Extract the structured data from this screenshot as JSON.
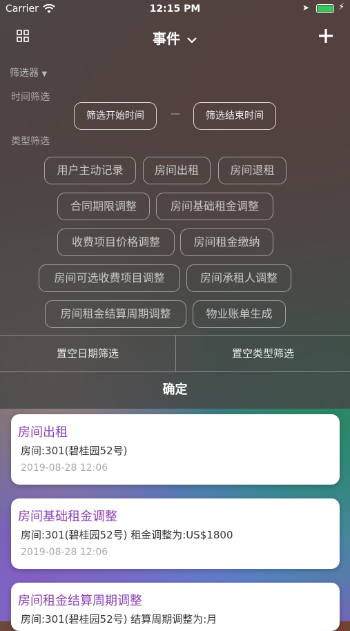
{
  "status_bar": {
    "carrier": "Carrier",
    "time": "12:15 PM"
  },
  "nav": {
    "title": "事件",
    "title_icon": "chevron-down-icon"
  },
  "filter": {
    "label": "筛选器",
    "time_label": "时间筛选",
    "start_button": "筛选开始时间",
    "separator": "—",
    "end_button": "筛选结束时间",
    "type_label": "类型筛选",
    "types": [
      "用户主动记录",
      "房间出租",
      "房间退租",
      "合同期限调整",
      "房间基础租金调整",
      "收费项目价格调整",
      "房间租金缴纳",
      "房间可选收费项目调整",
      "房间承租人调整",
      "房间租金结算周期调整",
      "物业账单生成"
    ],
    "clear_date": "置空日期筛选",
    "clear_type": "置空类型筛选",
    "confirm": "确定"
  },
  "events": [
    {
      "title": "房间出租",
      "detail": "房间:301(碧桂园52号)",
      "date": "2019-08-28 12:06"
    },
    {
      "title": "房间基础租金调整",
      "detail": "房间:301(碧桂园52号) 租金调整为:US$1800",
      "date": "2019-08-28 12:06"
    },
    {
      "title": "房间租金结算周期调整",
      "detail": "房间:301(碧桂园52号) 结算周期调整为:月",
      "date": ""
    }
  ],
  "colors": {
    "accent": "#8a40b8",
    "battery": "#35c759"
  }
}
